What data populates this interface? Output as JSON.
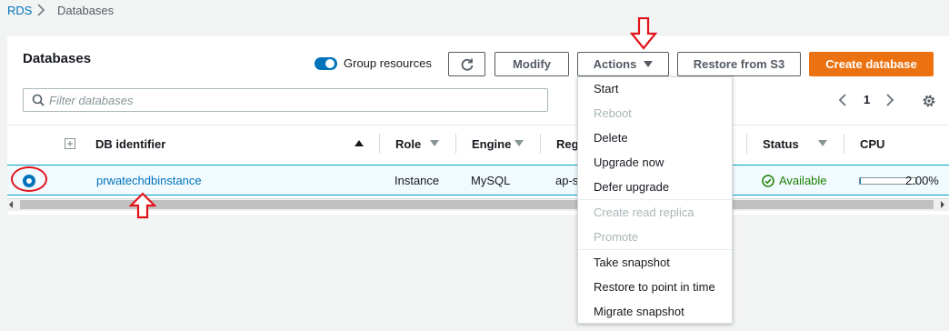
{
  "breadcrumb": {
    "root": "RDS",
    "current": "Databases"
  },
  "panel": {
    "title": "Databases"
  },
  "toggle": {
    "label": "Group resources",
    "on": true
  },
  "toolbar": {
    "modify_label": "Modify",
    "actions_label": "Actions",
    "restore_label": "Restore from S3",
    "create_label": "Create database"
  },
  "filter": {
    "placeholder": "Filter databases",
    "value": ""
  },
  "pagination": {
    "page": "1"
  },
  "table": {
    "headers": {
      "db_identifier": "DB identifier",
      "role": "Role",
      "engine": "Engine",
      "region": "Reg",
      "status": "Status",
      "cpu": "CPU"
    },
    "rows": [
      {
        "db_identifier": "prwatechdbinstance",
        "role": "Instance",
        "engine": "MySQL",
        "region": "ap-s",
        "status": "Available",
        "cpu": "2.00%",
        "cpu_fraction": 0.02,
        "selected": true
      }
    ]
  },
  "actions_menu": {
    "items": [
      {
        "label": "Start",
        "enabled": true
      },
      {
        "label": "Reboot",
        "enabled": false
      },
      {
        "label": "Delete",
        "enabled": true
      },
      {
        "label": "Upgrade now",
        "enabled": true
      },
      {
        "label": "Defer upgrade",
        "enabled": true
      },
      {
        "label": "Create read replica",
        "enabled": false
      },
      {
        "label": "Promote",
        "enabled": false
      },
      {
        "label": "Take snapshot",
        "enabled": true
      },
      {
        "label": "Restore to point in time",
        "enabled": true
      },
      {
        "label": "Migrate snapshot",
        "enabled": true
      }
    ]
  },
  "colors": {
    "accent": "#0073bb",
    "primary_button": "#ec7211",
    "status_ok": "#1d8102",
    "annotation": "#e2131a"
  },
  "icons": [
    "chevron-right-icon",
    "refresh-icon",
    "caret-down-icon",
    "search-icon",
    "chevron-left-icon",
    "gear-icon",
    "expand-icon",
    "check-circle-icon",
    "down-arrow-annotation-icon",
    "up-arrow-annotation-icon"
  ]
}
